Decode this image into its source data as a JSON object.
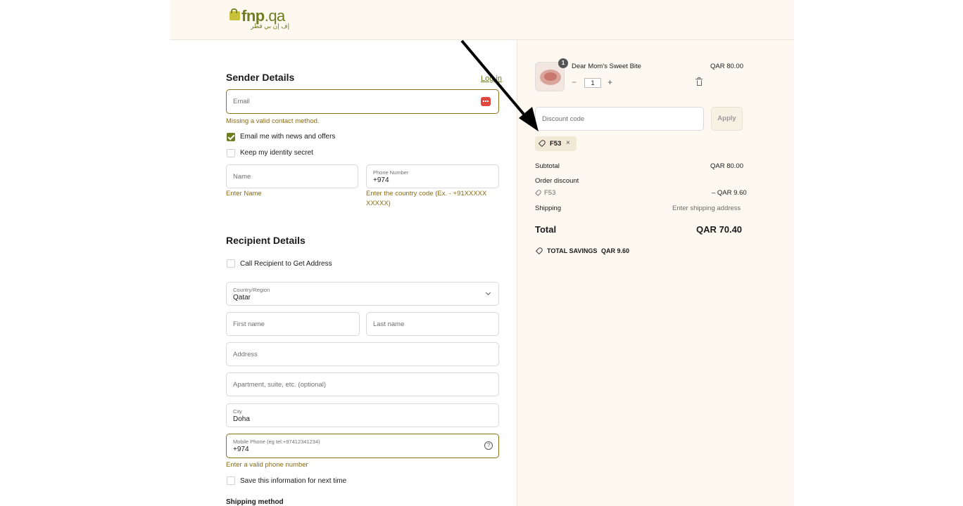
{
  "brand": {
    "logo_text": "fnp",
    "logo_tld": ".qa",
    "logo_sub": "إف إن بي قطر"
  },
  "sender": {
    "title": "Sender Details",
    "login_label": "Log in",
    "email_placeholder": "Email",
    "email_error": "Missing a valid contact method.",
    "news_label": "Email me with news and offers",
    "news_checked": true,
    "secret_label": "Keep my identity secret",
    "secret_checked": false,
    "name_placeholder": "Name",
    "name_error": "Enter Name",
    "phone_label": "Phone Number",
    "phone_value": "+974",
    "phone_error": "Enter the country code (Ex. - +91XXXXX XXXXX)"
  },
  "recipient": {
    "title": "Recipient Details",
    "call_label": "Call Recipient to Get Address",
    "country_label": "Country/Region",
    "country_value": "Qatar",
    "first_name_placeholder": "First name",
    "last_name_placeholder": "Last name",
    "address_placeholder": "Address",
    "apartment_placeholder": "Apartment, suite, etc. (optional)",
    "city_label": "City",
    "city_value": "Doha",
    "mobile_label": "Mobile Phone (eg tel:+97412341234)",
    "mobile_value": "+974",
    "mobile_error": "Enter a valid phone number",
    "save_label": "Save this information for next time"
  },
  "shipping_method_title": "Shipping method",
  "order": {
    "product_name": "Dear Mom's Sweet Bite",
    "product_price": "QAR 80.00",
    "quantity_badge": "1",
    "quantity": "1",
    "minus": "−",
    "plus": "+",
    "discount_placeholder": "Discount code",
    "apply_label": "Apply",
    "code_tag": "F53",
    "subtotal_label": "Subtotal",
    "subtotal_value": "QAR 80.00",
    "order_discount_label": "Order discount",
    "discount_code": "F53",
    "discount_value": "– QAR 9.60",
    "shipping_label": "Shipping",
    "shipping_value": "Enter shipping address",
    "total_label": "Total",
    "total_value": "QAR 70.40",
    "savings_label": "TOTAL SAVINGS",
    "savings_value": "QAR 9.60"
  },
  "colors": {
    "accent": "#6f7d23",
    "error": "#8a6a12",
    "panel": "#fdf9f1"
  }
}
